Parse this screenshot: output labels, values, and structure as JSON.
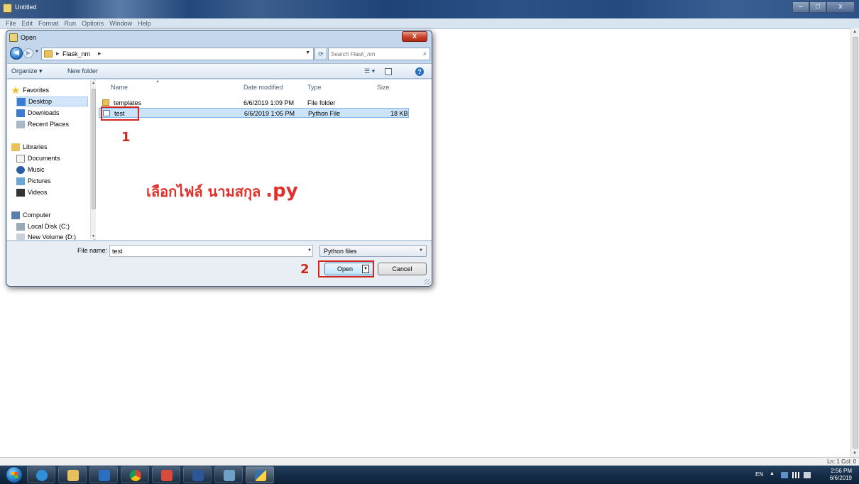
{
  "window": {
    "title": "Untitled",
    "menu": [
      "File",
      "Edit",
      "Format",
      "Run",
      "Options",
      "Window",
      "Help"
    ],
    "status": "Ln: 1  Col: 0"
  },
  "dialog": {
    "title": "Open",
    "address": {
      "crumb": "Flask_nm"
    },
    "search_placeholder": "Search Flask_nm",
    "toolbar": {
      "organize": "Organize ▾",
      "new_folder": "New folder"
    },
    "nav": {
      "favorites": "Favorites",
      "desktop": "Desktop",
      "downloads": "Downloads",
      "recent_places": "Recent Places",
      "libraries": "Libraries",
      "documents": "Documents",
      "music": "Music",
      "pictures": "Pictures",
      "videos": "Videos",
      "computer": "Computer",
      "local_disk": "Local Disk (C:)",
      "new_volume": "New Volume (D:)"
    },
    "columns": {
      "name": "Name",
      "date_modified": "Date modified",
      "type": "Type",
      "size": "Size"
    },
    "files": [
      {
        "name": "templates",
        "date": "6/6/2019 1:09 PM",
        "type": "File folder",
        "size": ""
      },
      {
        "name": "test",
        "date": "6/6/2019 1:05 PM",
        "type": "Python File",
        "size": "18 KB"
      }
    ],
    "file_name_label": "File name:",
    "file_name_value": "test",
    "file_type": "Python files",
    "open_label": "Open",
    "cancel_label": "Cancel"
  },
  "annotations": {
    "step1": "1",
    "step2": "2",
    "instruction": "เลือกไฟล์ นามสกุล",
    "instruction_ext": ".py"
  },
  "taskbar": {
    "lang": "EN",
    "time": "2:56 PM",
    "date": "6/6/2019"
  },
  "colors": {
    "annotation_red": "#d0261f",
    "selection_blue": "#cce4fa"
  }
}
